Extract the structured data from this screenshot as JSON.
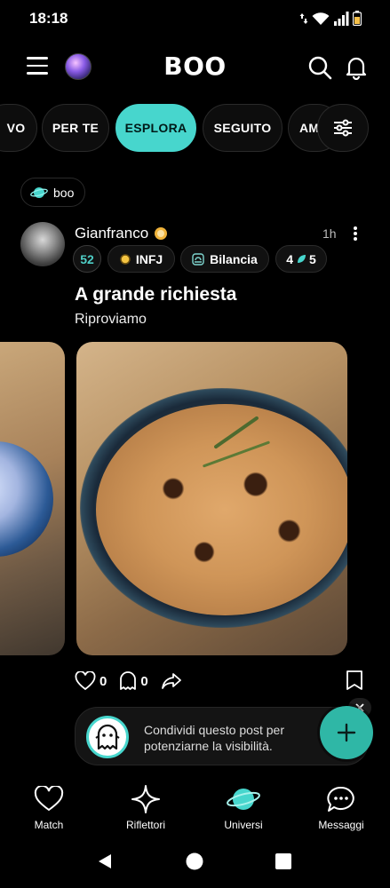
{
  "status": {
    "time": "18:18"
  },
  "header": {
    "logo": "BOO"
  },
  "tabs": [
    {
      "label": "VO"
    },
    {
      "label": "PER TE"
    },
    {
      "label": "ESPLORA"
    },
    {
      "label": "SEGUITO"
    },
    {
      "label": "AM"
    }
  ],
  "chip": {
    "label": "boo"
  },
  "post": {
    "author": "Gianfranco",
    "time": "1h",
    "level": "52",
    "mbti": "INFJ",
    "zodiac": "Bilancia",
    "karma_left": "4",
    "karma_right": "5",
    "title": "A grande richiesta",
    "subtitle": "Riproviamo",
    "likes": "0",
    "comments": "0"
  },
  "share": {
    "text": "Condividi questo post per potenziarne la visibilità."
  },
  "nav": [
    {
      "label": "Match"
    },
    {
      "label": "Riflettori"
    },
    {
      "label": "Universi"
    },
    {
      "label": "Messaggi"
    }
  ],
  "colors": {
    "accent": "#47d6cd",
    "background": "#000000",
    "fab": "#2fb7a6"
  }
}
